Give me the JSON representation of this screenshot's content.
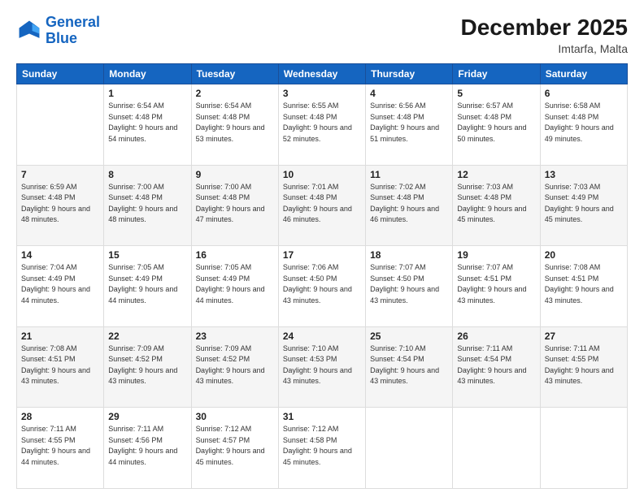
{
  "header": {
    "logo_line1": "General",
    "logo_line2": "Blue",
    "title": "December 2025",
    "subtitle": "Imtarfa, Malta"
  },
  "days_of_week": [
    "Sunday",
    "Monday",
    "Tuesday",
    "Wednesday",
    "Thursday",
    "Friday",
    "Saturday"
  ],
  "weeks": [
    [
      {
        "day": "",
        "sunrise": "",
        "sunset": "",
        "daylight": ""
      },
      {
        "day": "1",
        "sunrise": "Sunrise: 6:54 AM",
        "sunset": "Sunset: 4:48 PM",
        "daylight": "Daylight: 9 hours and 54 minutes."
      },
      {
        "day": "2",
        "sunrise": "Sunrise: 6:54 AM",
        "sunset": "Sunset: 4:48 PM",
        "daylight": "Daylight: 9 hours and 53 minutes."
      },
      {
        "day": "3",
        "sunrise": "Sunrise: 6:55 AM",
        "sunset": "Sunset: 4:48 PM",
        "daylight": "Daylight: 9 hours and 52 minutes."
      },
      {
        "day": "4",
        "sunrise": "Sunrise: 6:56 AM",
        "sunset": "Sunset: 4:48 PM",
        "daylight": "Daylight: 9 hours and 51 minutes."
      },
      {
        "day": "5",
        "sunrise": "Sunrise: 6:57 AM",
        "sunset": "Sunset: 4:48 PM",
        "daylight": "Daylight: 9 hours and 50 minutes."
      },
      {
        "day": "6",
        "sunrise": "Sunrise: 6:58 AM",
        "sunset": "Sunset: 4:48 PM",
        "daylight": "Daylight: 9 hours and 49 minutes."
      }
    ],
    [
      {
        "day": "7",
        "sunrise": "Sunrise: 6:59 AM",
        "sunset": "Sunset: 4:48 PM",
        "daylight": "Daylight: 9 hours and 48 minutes."
      },
      {
        "day": "8",
        "sunrise": "Sunrise: 7:00 AM",
        "sunset": "Sunset: 4:48 PM",
        "daylight": "Daylight: 9 hours and 48 minutes."
      },
      {
        "day": "9",
        "sunrise": "Sunrise: 7:00 AM",
        "sunset": "Sunset: 4:48 PM",
        "daylight": "Daylight: 9 hours and 47 minutes."
      },
      {
        "day": "10",
        "sunrise": "Sunrise: 7:01 AM",
        "sunset": "Sunset: 4:48 PM",
        "daylight": "Daylight: 9 hours and 46 minutes."
      },
      {
        "day": "11",
        "sunrise": "Sunrise: 7:02 AM",
        "sunset": "Sunset: 4:48 PM",
        "daylight": "Daylight: 9 hours and 46 minutes."
      },
      {
        "day": "12",
        "sunrise": "Sunrise: 7:03 AM",
        "sunset": "Sunset: 4:48 PM",
        "daylight": "Daylight: 9 hours and 45 minutes."
      },
      {
        "day": "13",
        "sunrise": "Sunrise: 7:03 AM",
        "sunset": "Sunset: 4:49 PM",
        "daylight": "Daylight: 9 hours and 45 minutes."
      }
    ],
    [
      {
        "day": "14",
        "sunrise": "Sunrise: 7:04 AM",
        "sunset": "Sunset: 4:49 PM",
        "daylight": "Daylight: 9 hours and 44 minutes."
      },
      {
        "day": "15",
        "sunrise": "Sunrise: 7:05 AM",
        "sunset": "Sunset: 4:49 PM",
        "daylight": "Daylight: 9 hours and 44 minutes."
      },
      {
        "day": "16",
        "sunrise": "Sunrise: 7:05 AM",
        "sunset": "Sunset: 4:49 PM",
        "daylight": "Daylight: 9 hours and 44 minutes."
      },
      {
        "day": "17",
        "sunrise": "Sunrise: 7:06 AM",
        "sunset": "Sunset: 4:50 PM",
        "daylight": "Daylight: 9 hours and 43 minutes."
      },
      {
        "day": "18",
        "sunrise": "Sunrise: 7:07 AM",
        "sunset": "Sunset: 4:50 PM",
        "daylight": "Daylight: 9 hours and 43 minutes."
      },
      {
        "day": "19",
        "sunrise": "Sunrise: 7:07 AM",
        "sunset": "Sunset: 4:51 PM",
        "daylight": "Daylight: 9 hours and 43 minutes."
      },
      {
        "day": "20",
        "sunrise": "Sunrise: 7:08 AM",
        "sunset": "Sunset: 4:51 PM",
        "daylight": "Daylight: 9 hours and 43 minutes."
      }
    ],
    [
      {
        "day": "21",
        "sunrise": "Sunrise: 7:08 AM",
        "sunset": "Sunset: 4:51 PM",
        "daylight": "Daylight: 9 hours and 43 minutes."
      },
      {
        "day": "22",
        "sunrise": "Sunrise: 7:09 AM",
        "sunset": "Sunset: 4:52 PM",
        "daylight": "Daylight: 9 hours and 43 minutes."
      },
      {
        "day": "23",
        "sunrise": "Sunrise: 7:09 AM",
        "sunset": "Sunset: 4:52 PM",
        "daylight": "Daylight: 9 hours and 43 minutes."
      },
      {
        "day": "24",
        "sunrise": "Sunrise: 7:10 AM",
        "sunset": "Sunset: 4:53 PM",
        "daylight": "Daylight: 9 hours and 43 minutes."
      },
      {
        "day": "25",
        "sunrise": "Sunrise: 7:10 AM",
        "sunset": "Sunset: 4:54 PM",
        "daylight": "Daylight: 9 hours and 43 minutes."
      },
      {
        "day": "26",
        "sunrise": "Sunrise: 7:11 AM",
        "sunset": "Sunset: 4:54 PM",
        "daylight": "Daylight: 9 hours and 43 minutes."
      },
      {
        "day": "27",
        "sunrise": "Sunrise: 7:11 AM",
        "sunset": "Sunset: 4:55 PM",
        "daylight": "Daylight: 9 hours and 43 minutes."
      }
    ],
    [
      {
        "day": "28",
        "sunrise": "Sunrise: 7:11 AM",
        "sunset": "Sunset: 4:55 PM",
        "daylight": "Daylight: 9 hours and 44 minutes."
      },
      {
        "day": "29",
        "sunrise": "Sunrise: 7:11 AM",
        "sunset": "Sunset: 4:56 PM",
        "daylight": "Daylight: 9 hours and 44 minutes."
      },
      {
        "day": "30",
        "sunrise": "Sunrise: 7:12 AM",
        "sunset": "Sunset: 4:57 PM",
        "daylight": "Daylight: 9 hours and 45 minutes."
      },
      {
        "day": "31",
        "sunrise": "Sunrise: 7:12 AM",
        "sunset": "Sunset: 4:58 PM",
        "daylight": "Daylight: 9 hours and 45 minutes."
      },
      {
        "day": "",
        "sunrise": "",
        "sunset": "",
        "daylight": ""
      },
      {
        "day": "",
        "sunrise": "",
        "sunset": "",
        "daylight": ""
      },
      {
        "day": "",
        "sunrise": "",
        "sunset": "",
        "daylight": ""
      }
    ]
  ]
}
